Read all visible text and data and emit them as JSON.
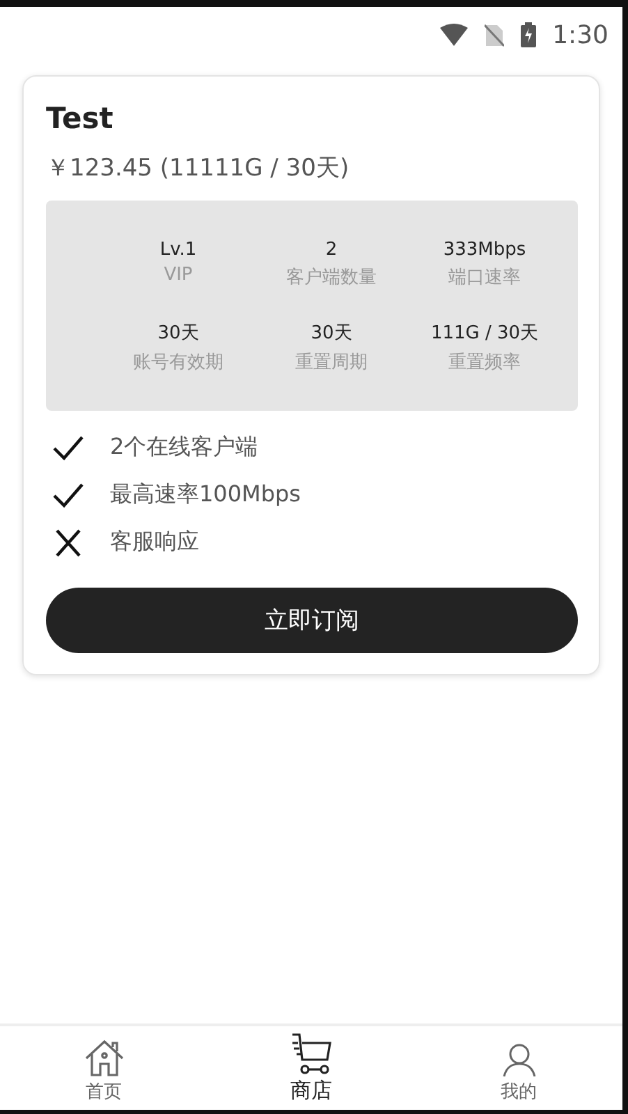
{
  "status_bar": {
    "time": "1:30"
  },
  "plan": {
    "title": "Test",
    "price": "￥123.45 (11111G / 30天)",
    "stats": [
      {
        "value": "Lv.1",
        "label": "VIP"
      },
      {
        "value": "2",
        "label": "客户端数量"
      },
      {
        "value": "333Mbps",
        "label": "端口速率"
      },
      {
        "value": "30天",
        "label": "账号有效期"
      },
      {
        "value": "30天",
        "label": "重置周期"
      },
      {
        "value": "111G / 30天",
        "label": "重置频率"
      }
    ],
    "features": [
      {
        "text": "2个在线客户端",
        "included": true
      },
      {
        "text": "最高速率100Mbps",
        "included": true
      },
      {
        "text": "客服响应",
        "included": false
      }
    ],
    "button": "立即订阅"
  },
  "tabs": [
    {
      "label": "首页",
      "kind": "home",
      "selected": false
    },
    {
      "label": "商店",
      "kind": "cart",
      "selected": true
    },
    {
      "label": "我的",
      "kind": "user",
      "selected": false
    }
  ]
}
